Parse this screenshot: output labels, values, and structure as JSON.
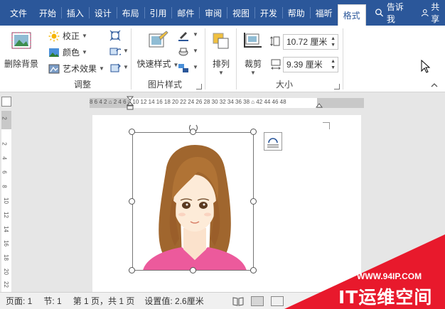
{
  "tabs": [
    {
      "label": "文件"
    },
    {
      "label": "开始"
    },
    {
      "label": "插入"
    },
    {
      "label": "设计"
    },
    {
      "label": "布局"
    },
    {
      "label": "引用"
    },
    {
      "label": "邮件"
    },
    {
      "label": "审阅"
    },
    {
      "label": "视图"
    },
    {
      "label": "开发"
    },
    {
      "label": "帮助"
    },
    {
      "label": "福昕"
    },
    {
      "label": "格式",
      "active": true
    }
  ],
  "tell_me": "告诉我",
  "share": "共享",
  "ribbon": {
    "remove_bg": "删除背景",
    "adjust": {
      "correct": "校正",
      "color": "颜色",
      "art": "艺术效果",
      "label": "调整"
    },
    "styles": {
      "quick": "快速样式",
      "label": "图片样式"
    },
    "arrange": {
      "label": "排列"
    },
    "size": {
      "crop": "裁剪",
      "height": "10.72 厘米",
      "width": "9.39 厘米",
      "label": "大小"
    }
  },
  "ruler": {
    "h": "8 6 4 2 ⌂ 2 4 6 8 10 12 14 16 18 20 22 24 26 28 30 32 34 36 38 ⌂ 42 44 46 48"
  },
  "status": {
    "page": "页面: 1",
    "section": "节: 1",
    "pages": "第 1 页，共 1 页",
    "setting": "设置值: 2.6厘米"
  },
  "watermark": {
    "url": "WWW.94IP.COM",
    "brand": "IT运维空间"
  },
  "colors": {
    "accent": "#2b579a",
    "watermark": "#e8192c"
  }
}
